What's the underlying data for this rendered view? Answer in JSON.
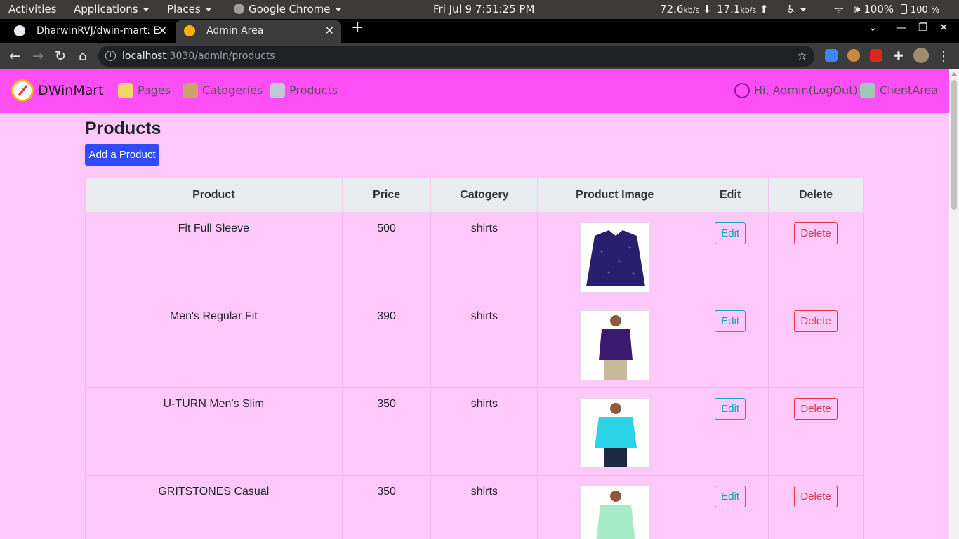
{
  "system_bar": {
    "activities": "Activities",
    "applications": "Applications",
    "places": "Places",
    "app_name": "Google Chrome",
    "datetime": "Fri Jul 9   7:51:25 PM",
    "net_down": "72.6",
    "net_down_unit": "kb/s",
    "net_up": "17.1",
    "net_up_unit": "kb/s",
    "volume": "100%",
    "battery": "100 %"
  },
  "browser": {
    "tabs": [
      {
        "title": "DharwinRVJ/dwin-mart: E",
        "active": false
      },
      {
        "title": "Admin Area",
        "active": true
      }
    ],
    "url_host": "localhost",
    "url_path": ":3030/admin/products"
  },
  "navbar": {
    "brand": "DWinMart",
    "links": [
      {
        "label": "Pages"
      },
      {
        "label": "Catogeries"
      },
      {
        "label": "Products"
      }
    ],
    "user_link": "Hi, Admin(LogOut)",
    "client_link": "ClientArea"
  },
  "page": {
    "title": "Products",
    "add_button": "Add a Product"
  },
  "table": {
    "headers": [
      "Product",
      "Price",
      "Catogery",
      "Product Image",
      "Edit",
      "Delete"
    ],
    "rows": [
      {
        "product": "Fit Full Sleeve",
        "price": "500",
        "category": "shirts",
        "edit": "Edit",
        "delete": "Delete",
        "image_color": "#2a1f6e"
      },
      {
        "product": "Men's Regular Fit",
        "price": "390",
        "category": "shirts",
        "edit": "Edit",
        "delete": "Delete",
        "image_color": "#3a1a70"
      },
      {
        "product": "U-TURN Men's Slim",
        "price": "350",
        "category": "shirts",
        "edit": "Edit",
        "delete": "Delete",
        "image_color": "#29d3e8"
      },
      {
        "product": "GRITSTONES Casual",
        "price": "350",
        "category": "shirts",
        "edit": "Edit",
        "delete": "Delete",
        "image_color": "#a6ecc8"
      }
    ]
  },
  "colors": {
    "page_bg": "#fec8fb",
    "navbar_bg": "#fe4ef5",
    "primary": "#2e4bff",
    "info": "#17a2b8",
    "danger": "#dc3545"
  }
}
